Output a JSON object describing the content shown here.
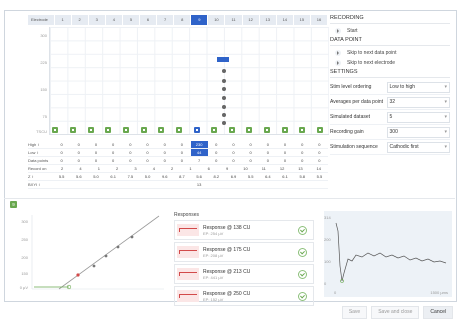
{
  "grid": {
    "header_label": "Electrode",
    "electrodes": [
      "1",
      "2",
      "3",
      "4",
      "5",
      "6",
      "7",
      "8",
      "9",
      "10",
      "11",
      "12",
      "13",
      "14",
      "15",
      "16"
    ],
    "selected_index": 8,
    "yticks": [
      "300",
      "225",
      "150",
      "75",
      "TSCU"
    ],
    "rows": [
      {
        "name": "High ↕",
        "values": [
          "0",
          "0",
          "0",
          "0",
          "0",
          "0",
          "0",
          "0",
          "230",
          "0",
          "0",
          "0",
          "0",
          "0",
          "0",
          "0"
        ]
      },
      {
        "name": "Low ↕",
        "values": [
          "0",
          "0",
          "0",
          "0",
          "0",
          "0",
          "0",
          "0",
          "44",
          "0",
          "0",
          "0",
          "0",
          "0",
          "0",
          "0"
        ]
      },
      {
        "name": "Data points",
        "values": [
          "0",
          "0",
          "0",
          "0",
          "0",
          "0",
          "0",
          "0",
          "7",
          "0",
          "0",
          "0",
          "0",
          "0",
          "0",
          "0"
        ]
      },
      {
        "name": "Record on",
        "values": [
          "2",
          "4",
          "1",
          "2",
          "3",
          "4",
          "2",
          "1",
          "6",
          "9",
          "10",
          "11",
          "12",
          "13",
          "14"
        ]
      },
      {
        "name": "Z ↕",
        "values": [
          "5.5",
          "5.6",
          "5.0",
          "6.1",
          "7.5",
          "5.0",
          "9.6",
          "8.7",
          "5.6",
          "8.2",
          "6.9",
          "5.5",
          "6.4",
          "6.1",
          "5.8",
          "5.5"
        ]
      },
      {
        "name": "BXYI ↕",
        "values": [
          "",
          "",
          "",
          "",
          "",
          "",
          "",
          "",
          "13",
          "",
          "",
          "",
          "",
          "",
          "",
          ""
        ]
      }
    ]
  },
  "panel": {
    "recording_title": "RECORDING",
    "start_label": "Start",
    "datapoint_title": "DATA POINT",
    "skip_data_point": "Skip to next data point",
    "skip_electrode": "Skip to next electrode",
    "settings_title": "SETTINGS",
    "settings": [
      {
        "label": "Stim level ordering",
        "value": "Low to high"
      },
      {
        "label": "Averages per data point",
        "value": "32"
      },
      {
        "label": "Simulated dataset",
        "value": "5"
      },
      {
        "label": "Recording gain",
        "value": "300"
      },
      {
        "label": "Stimulation sequence",
        "value": "Cathodic first"
      }
    ]
  },
  "bottom": {
    "badge": "9",
    "growth_yticks": [
      "300",
      "250",
      "200",
      "150",
      "0 µV"
    ],
    "responses_title": "Responses",
    "responses": [
      {
        "title": "Response @ 138 CU",
        "sub": "EP: 254 µV"
      },
      {
        "title": "Response @ 175 CU",
        "sub": "EP: 208 µV"
      },
      {
        "title": "Response @ 213 CU",
        "sub": "EP: 441 µV"
      },
      {
        "title": "Response @ 250 CU",
        "sub": "EP: 152 µV"
      }
    ],
    "wave_yticks": [
      "314",
      "200",
      "100",
      "0"
    ],
    "wave_xlabels": [
      "0",
      "1500 µms"
    ]
  },
  "footer": {
    "save": "Save",
    "save_close": "Save and close",
    "cancel": "Cancel"
  },
  "colors": {
    "accent": "#2f63c9",
    "ok": "#69a84f",
    "response": "#d24a4a"
  }
}
